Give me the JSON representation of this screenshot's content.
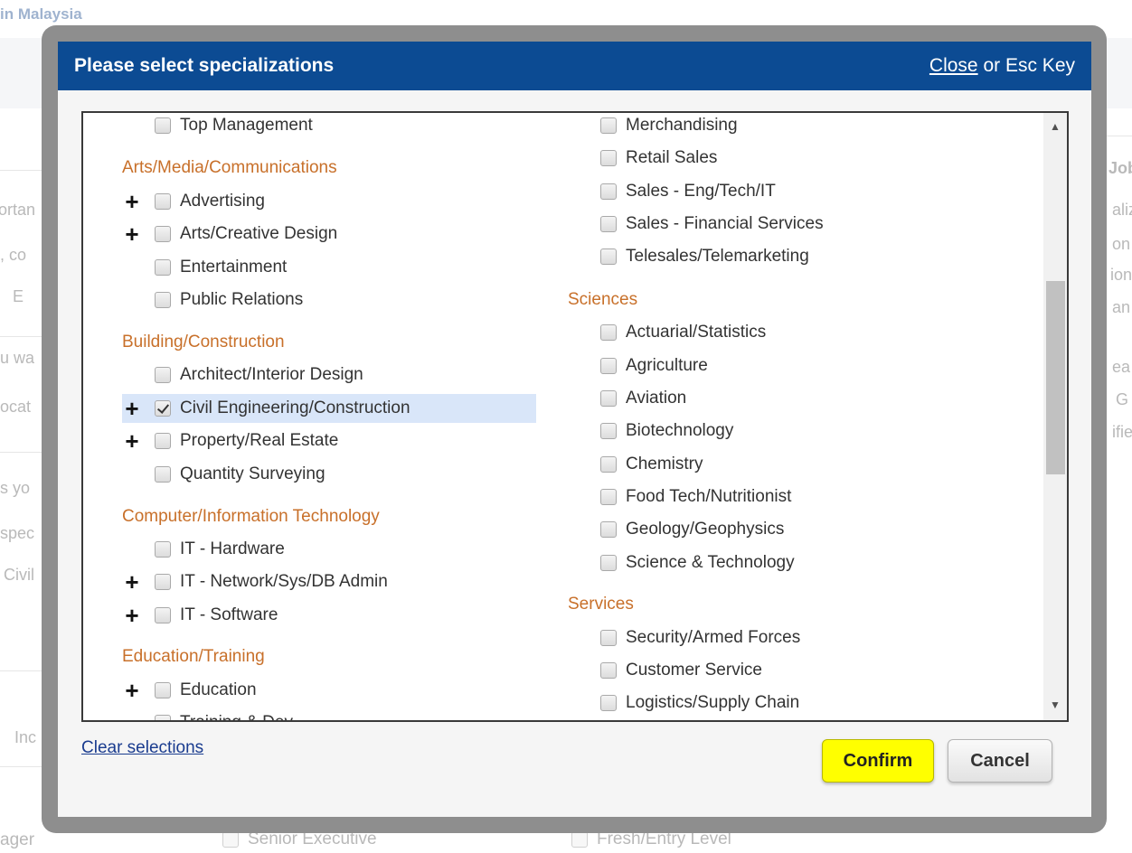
{
  "background": {
    "top_text": "in Malaysia",
    "left_fragments": [
      "ortan",
      ", co",
      "E",
      "u wa",
      "ocat",
      "s yo",
      "spec",
      "Civil",
      "Inc",
      "ager"
    ],
    "right_fragments": [
      "Job",
      "aliz",
      "on",
      "ion",
      "an",
      "ea",
      "G",
      "ifie"
    ],
    "bottom_checks": [
      "Senior Executive",
      "Fresh/Entry Level"
    ]
  },
  "dialog": {
    "title": "Please select specializations",
    "close_link": "Close",
    "close_suffix": " or Esc Key",
    "clear_link": "Clear selections",
    "confirm": "Confirm",
    "cancel": "Cancel"
  },
  "left_column": {
    "top_item": "Top Management",
    "cat_arts": "Arts/Media/Communications",
    "arts": [
      "Advertising",
      "Arts/Creative Design",
      "Entertainment",
      "Public Relations"
    ],
    "cat_building": "Building/Construction",
    "building": [
      "Architect/Interior Design",
      "Civil Engineering/Construction",
      "Property/Real Estate",
      "Quantity Surveying"
    ],
    "cat_computer": "Computer/Information Technology",
    "computer": [
      "IT - Hardware",
      "IT - Network/Sys/DB Admin",
      "IT - Software"
    ],
    "cat_education": "Education/Training",
    "education": [
      "Education",
      "Training & Dev."
    ]
  },
  "right_column": {
    "sales": [
      "Merchandising",
      "Retail Sales",
      "Sales - Eng/Tech/IT",
      "Sales - Financial Services",
      "Telesales/Telemarketing"
    ],
    "cat_sciences": "Sciences",
    "sciences": [
      "Actuarial/Statistics",
      "Agriculture",
      "Aviation",
      "Biotechnology",
      "Chemistry",
      "Food Tech/Nutritionist",
      "Geology/Geophysics",
      "Science & Technology"
    ],
    "cat_services": "Services",
    "services": [
      "Security/Armed Forces",
      "Customer Service",
      "Logistics/Supply Chain"
    ]
  },
  "colors": {
    "header_bg": "#0c4b93",
    "category_text": "#c8702a",
    "selected_row": "#d9e6f9",
    "confirm_bg": "#ffff00"
  }
}
